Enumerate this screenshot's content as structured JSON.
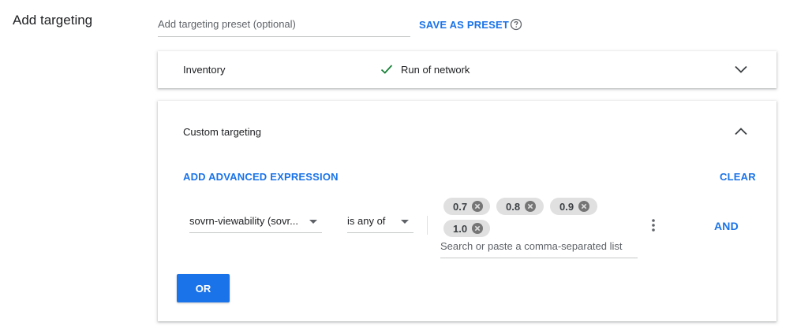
{
  "section": {
    "title": "Add targeting"
  },
  "preset": {
    "placeholder": "Add targeting preset (optional)",
    "save_label": "SAVE AS PRESET",
    "help_icon": "help-circle-icon"
  },
  "inventory": {
    "label": "Inventory",
    "value": "Run of network",
    "status_icon": "check-icon",
    "status_color": "#188038",
    "expand_icon": "chevron-down-icon"
  },
  "custom_targeting": {
    "label": "Custom targeting",
    "collapse_icon": "chevron-up-icon",
    "add_expression_label": "ADD ADVANCED EXPRESSION",
    "clear_label": "CLEAR",
    "key_select": "sovrn-viewability (sovr...",
    "operator_select": "is any of",
    "values": [
      "0.7",
      "0.8",
      "0.9",
      "1.0"
    ],
    "search_placeholder": "Search or paste a comma-separated list",
    "and_label": "AND",
    "or_label": "OR"
  },
  "colors": {
    "accent": "#1a73e8",
    "chip_bg": "#e0e0e0"
  }
}
